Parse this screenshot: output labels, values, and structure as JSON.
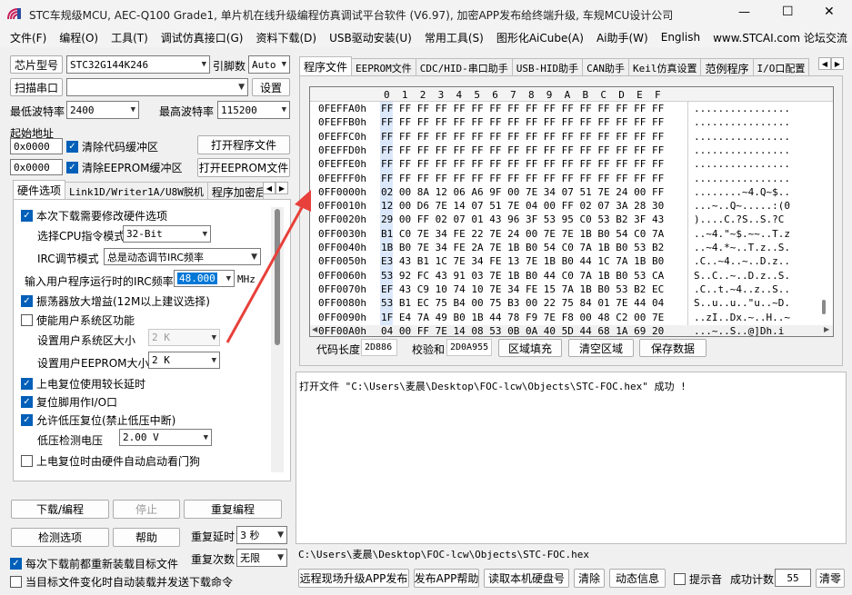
{
  "app": {
    "title": "STC车规级MCU, AEC-Q100 Grade1, 单片机在线升级编程仿真调试平台软件 (V6.97), 加密APP发布给终端升级, 车规MCU设计公司",
    "window_controls": {
      "minimize": "—",
      "maximize": "☐",
      "close": "✕"
    }
  },
  "menu": [
    "文件(F)",
    "编程(O)",
    "工具(T)",
    "调试仿真接口(G)",
    "资料下载(D)",
    "USB驱动安装(U)",
    "常用工具(S)",
    "图形化AiCube(A)",
    "Ai助手(W)",
    "English",
    "www.STCAI.com 论坛交流"
  ],
  "left": {
    "chip_btn": "芯片型号",
    "chip_value": "STC32G144K246",
    "pins_label": "引脚数",
    "pins_value": "Auto",
    "scan_btn": "扫描串口",
    "port_value": "",
    "settings_btn": "设置",
    "min_baud_label": "最低波特率",
    "min_baud_value": "2400",
    "max_baud_label": "最高波特率",
    "max_baud_value": "115200",
    "start_addr_label": "起始地址",
    "code_addr": "0x0000",
    "clear_code_label": "清除代码缓冲区",
    "open_prog_btn": "打开程序文件",
    "eeprom_addr": "0x0000",
    "clear_eeprom_label": "清除EEPROM缓冲区",
    "open_eeprom_btn": "打开EEPROM文件",
    "subtabs": [
      "硬件选项",
      "Link1D/Writer1A/U8W脱机",
      "程序加密后"
    ],
    "hw": {
      "modify_hw": "本次下载需要修改硬件选项",
      "cpu_mode_label": "选择CPU指令模式",
      "cpu_mode_value": "32-Bit",
      "irc_mode_label": "IRC调节模式",
      "irc_mode_value": "总是动态调节IRC频率",
      "irc_freq_label": "输入用户程序运行时的IRC频率",
      "irc_freq_value": "48.000",
      "irc_freq_unit": "MHz",
      "osc_gain": "振荡器放大增益(12M以上建议选择)",
      "user_sys_area": "使能用户系统区功能",
      "sys_area_size_label": "设置用户系统区大小",
      "sys_area_size_value": "2  K",
      "eeprom_size_label": "设置用户EEPROM大小",
      "eeprom_size_value": "2  K",
      "long_delay": "上电复位使用较长延时",
      "reset_io": "复位脚用作I/O口",
      "lvr": "允许低压复位(禁止低压中断)",
      "lv_label": "低压检测电压",
      "lv_value": "2.00 V",
      "wdt": "上电复位时由硬件自动启动看门狗"
    },
    "download_btn": "下载/编程",
    "stop_btn": "停止",
    "reprogram_btn": "重复编程",
    "check_btn": "检测选项",
    "help_btn": "帮助",
    "repeat_delay_label": "重复延时",
    "repeat_delay_value": "3 秒",
    "repeat_count_label": "重复次数",
    "repeat_count_value": "无限",
    "reload_each": "每次下载前都重新装载目标文件",
    "auto_send": "当目标文件变化时自动装载并发送下载命令"
  },
  "right": {
    "tabs": [
      "程序文件",
      "EEPROM文件",
      "CDC/HID-串口助手",
      "USB-HID助手",
      "CAN助手",
      "Keil仿真设置",
      "范例程序",
      "I/O口配置"
    ],
    "hex_header": "0  1  2  3  4  5  6  7  8  9  A  B  C  D  E  F",
    "hex_rows": [
      {
        "addr": "0FEFFA0h",
        "bytes": "FF FF FF FF FF FF FF FF FF FF FF FF FF FF FF FF",
        "ascii": "................"
      },
      {
        "addr": "0FEFFB0h",
        "bytes": "FF FF FF FF FF FF FF FF FF FF FF FF FF FF FF FF",
        "ascii": "................"
      },
      {
        "addr": "0FEFFC0h",
        "bytes": "FF FF FF FF FF FF FF FF FF FF FF FF FF FF FF FF",
        "ascii": "................"
      },
      {
        "addr": "0FEFFD0h",
        "bytes": "FF FF FF FF FF FF FF FF FF FF FF FF FF FF FF FF",
        "ascii": "................"
      },
      {
        "addr": "0FEFFE0h",
        "bytes": "FF FF FF FF FF FF FF FF FF FF FF FF FF FF FF FF",
        "ascii": "................"
      },
      {
        "addr": "0FEFFF0h",
        "bytes": "FF FF FF FF FF FF FF FF FF FF FF FF FF FF FF FF",
        "ascii": "................"
      },
      {
        "addr": "0FF0000h",
        "bytes": "02 00 8A 12 06 A6 9F 00 7E 34 07 51 7E 24 00 FF",
        "ascii": "........~4.Q~$.."
      },
      {
        "addr": "0FF0010h",
        "bytes": "12 00 D6 7E 14 07 51 7E 04 00 FF 02 07 3A 28 30",
        "ascii": "...~..Q~.....:(0"
      },
      {
        "addr": "0FF0020h",
        "bytes": "29 00 FF 02 07 01 43 96 3F 53 95 C0 53 B2 3F 43",
        "ascii": ")....C.?S..S.?C"
      },
      {
        "addr": "0FF0030h",
        "bytes": "B1 C0 7E 34 FE 22 7E 24 00 7E 7E 1B B0 54 C0 7A",
        "ascii": "..~4.\"~$.~~..T.z"
      },
      {
        "addr": "0FF0040h",
        "bytes": "1B B0 7E 34 FE 2A 7E 1B B0 54 C0 7A 1B B0 53 B2",
        "ascii": "..~4.*~..T.z..S."
      },
      {
        "addr": "0FF0050h",
        "bytes": "E3 43 B1 1C 7E 34 FE 13 7E 1B B0 44 1C 7A 1B B0",
        "ascii": ".C..~4..~..D.z.."
      },
      {
        "addr": "0FF0060h",
        "bytes": "53 92 FC 43 91 03 7E 1B B0 44 C0 7A 1B B0 53 CA",
        "ascii": "S..C..~..D.z..S."
      },
      {
        "addr": "0FF0070h",
        "bytes": "EF 43 C9 10 74 10 7E 34 FE 15 7A 1B B0 53 B2 EC",
        "ascii": ".C..t.~4..z..S.."
      },
      {
        "addr": "0FF0080h",
        "bytes": "53 B1 EC 75 B4 00 75 B3 00 22 75 84 01 7E 44 04",
        "ascii": "S..u..u..\"u..~D."
      },
      {
        "addr": "0FF0090h",
        "bytes": "1F E4 7A 49 B0 1B 44 78 F9 7E F8 00 48 C2 00 7E",
        "ascii": "..zI..Dx.~..H..~"
      },
      {
        "addr": "0FF00A0h",
        "bytes": "04 00 FF 7E 14 08 53 0B 0A 40 5D 44 68 1A 69 20",
        "ascii": "...~..S..@]Dh.i "
      }
    ],
    "code_len_label": "代码长度",
    "code_len_value": "2D886",
    "checksum_label": "校验和",
    "checksum_value": "2D0A955",
    "fill_btn": "区域填充",
    "clear_btn": "清空区域",
    "save_btn": "保存数据",
    "log_text": "打开文件 \"C:\\Users\\麦晨\\Desktop\\FOC-lcw\\Objects\\STC-FOC.hex\" 成功 !",
    "file_path": "C:\\Users\\麦晨\\Desktop\\FOC-lcw\\Objects\\STC-FOC.hex",
    "bottom_buttons": [
      "远程现场升级APP发布",
      "发布APP帮助",
      "读取本机硬盘号",
      "清除",
      "动态信息"
    ],
    "sound_label": "提示音",
    "success_label": "成功计数",
    "success_value": "55",
    "clear_count_btn": "清零"
  },
  "colors": {
    "accent": "#005fb8",
    "arrow": "#e8403a",
    "hex_bg": "#ffffff"
  }
}
